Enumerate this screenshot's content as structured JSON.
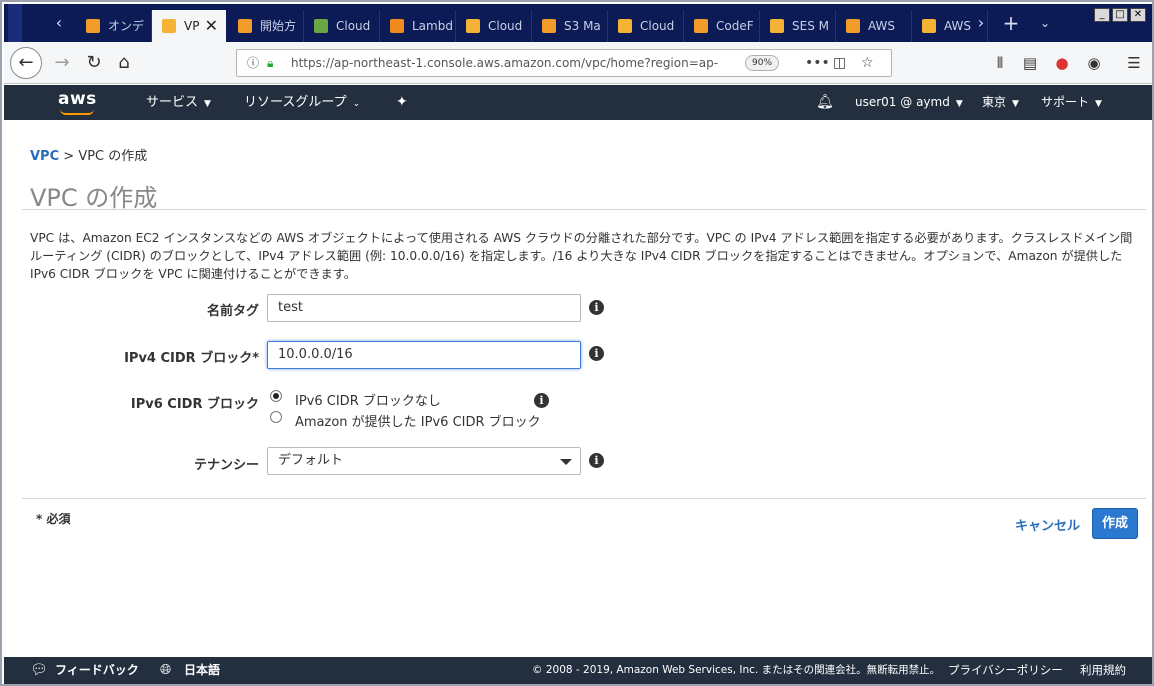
{
  "browser": {
    "tabs": [
      {
        "label": "オンデ",
        "color": "#f39c2a"
      },
      {
        "label": "VP",
        "color": "#f5b335",
        "active": true
      },
      {
        "label": "開始方",
        "color": "#f39c2a"
      },
      {
        "label": "Cloud",
        "color": "#6aa641"
      },
      {
        "label": "Lambd",
        "color": "#f08a1c"
      },
      {
        "label": "Cloud",
        "color": "#f5b335"
      },
      {
        "label": "S3 Ma",
        "color": "#f39c2a"
      },
      {
        "label": "Cloud",
        "color": "#f5b335"
      },
      {
        "label": "CodeF",
        "color": "#f39c2a"
      },
      {
        "label": "SES M",
        "color": "#f5b335"
      },
      {
        "label": "AWS",
        "color": "#f39c2a"
      },
      {
        "label": "AWS",
        "color": "#f5b335"
      }
    ],
    "close_glyph": "✕",
    "url": "https://ap-northeast-1.console.aws.amazon.com/vpc/home?region=ap-",
    "zoom": "90%"
  },
  "aws_header": {
    "logo": "aws",
    "services": "サービス",
    "resource_groups": "リソースグループ",
    "user": "user01 @ aymd",
    "region": "東京",
    "support": "サポート"
  },
  "breadcrumb": {
    "root": "VPC",
    "sep": ">",
    "current": "VPC の作成"
  },
  "page": {
    "title": "VPC の作成",
    "description": "VPC は、Amazon EC2 インスタンスなどの AWS オブジェクトによって使用される AWS クラウドの分離された部分です。VPC の IPv4 アドレス範囲を指定する必要があります。クラスレスドメイン間ルーティング (CIDR) のブロックとして、IPv4 アドレス範囲 (例: 10.0.0.0/16) を指定します。/16 より大きな IPv4 CIDR ブロックを指定することはできません。オプションで、Amazon が提供した IPv6 CIDR ブロックを VPC に関連付けることができます。"
  },
  "form": {
    "name_tag_label": "名前タグ",
    "name_tag_value": "test",
    "ipv4_label": "IPv4 CIDR ブロック*",
    "ipv4_value": "10.0.0.0/16",
    "ipv6_label": "IPv6 CIDR ブロック",
    "ipv6_option_none": "IPv6 CIDR ブロックなし",
    "ipv6_option_amazon": "Amazon が提供した IPv6 CIDR ブロック",
    "tenancy_label": "テナンシー",
    "tenancy_value": "デフォルト",
    "info_glyph": "i"
  },
  "actions": {
    "required_note": "* 必須",
    "cancel": "キャンセル",
    "create": "作成"
  },
  "footer": {
    "feedback": "フィードバック",
    "language": "日本語",
    "copyright": "© 2008 - 2019, Amazon Web Services, Inc. またはその関連会社。無断転用禁止。",
    "privacy": "プライバシーポリシー",
    "terms": "利用規約"
  }
}
